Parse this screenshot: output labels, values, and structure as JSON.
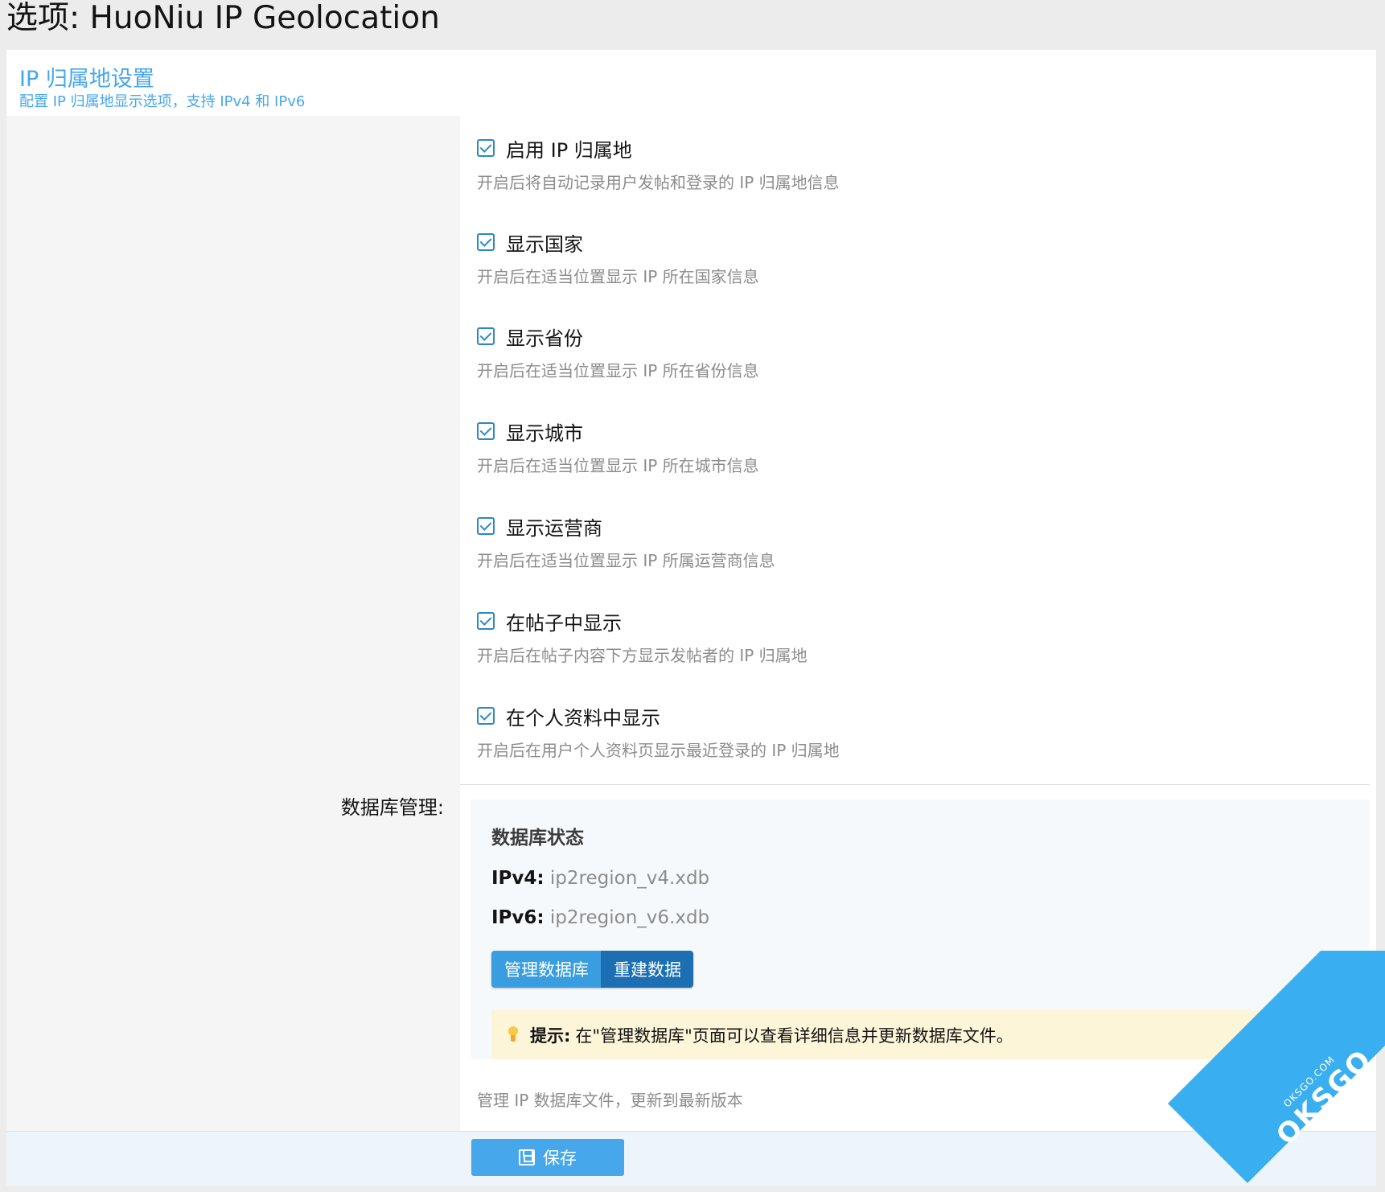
{
  "page": {
    "title": "选项: HuoNiu IP Geolocation"
  },
  "block": {
    "title": "IP 归属地设置",
    "description": "配置 IP 归属地显示选项，支持 IPv4 和 IPv6"
  },
  "options": [
    {
      "label": "启用 IP 归属地",
      "hint": "开启后将自动记录用户发帖和登录的 IP 归属地信息",
      "checked": true
    },
    {
      "label": "显示国家",
      "hint": "开启后在适当位置显示 IP 所在国家信息",
      "checked": true
    },
    {
      "label": "显示省份",
      "hint": "开启后在适当位置显示 IP 所在省份信息",
      "checked": true
    },
    {
      "label": "显示城市",
      "hint": "开启后在适当位置显示 IP 所在城市信息",
      "checked": true
    },
    {
      "label": "显示运营商",
      "hint": "开启后在适当位置显示 IP 所属运营商信息",
      "checked": true
    },
    {
      "label": "在帖子中显示",
      "hint": "开启后在帖子内容下方显示发帖者的 IP 归属地",
      "checked": true
    },
    {
      "label": "在个人资料中显示",
      "hint": "开启后在用户个人资料页显示最近登录的 IP 归属地",
      "checked": true
    }
  ],
  "database": {
    "row_label": "数据库管理:",
    "status_title": "数据库状态",
    "ipv4_label": "IPv4:",
    "ipv4_value": "ip2region_v4.xdb",
    "ipv6_label": "IPv6:",
    "ipv6_value": "ip2region_v6.xdb",
    "manage_button": "管理数据库",
    "rebuild_button": "重建数据",
    "tip_label": "提示:",
    "tip_text": "在\"管理数据库\"页面可以查看详细信息并更新数据库文件。",
    "hint": "管理 IP 数据库文件，更新到最新版本"
  },
  "footer": {
    "save_label": "保存"
  },
  "watermark": {
    "main": "OKSGO",
    "sub": "OKSGO.COM"
  },
  "colors": {
    "accent": "#47a7eb",
    "checkbox": "#2b88c7",
    "rebuild_button": "#1d6fb3",
    "tip_background": "#fdf5d8"
  }
}
